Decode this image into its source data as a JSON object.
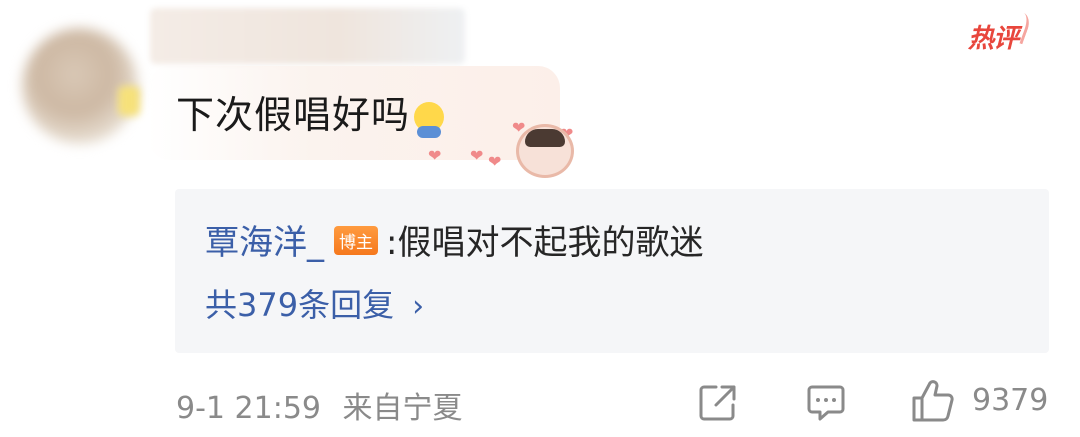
{
  "header": {
    "hot_label": "热评"
  },
  "comment": {
    "text": "下次假唱好吗",
    "emoji": "cold-sweat-emoji"
  },
  "reply": {
    "author": "覃海洋_",
    "badge": "博主",
    "separator": ":",
    "text": "假唱对不起我的歌迷",
    "count_label": "共379条回复",
    "chevron": "›"
  },
  "footer": {
    "timestamp": "9-1 21:59",
    "location": "来自宁夏",
    "like_count": "9379"
  },
  "colors": {
    "hot": "#e8463c",
    "link": "#3b5fa8",
    "badge": "#f5781d",
    "meta": "#8a8a8a",
    "reply_bg": "#f5f6f8"
  }
}
